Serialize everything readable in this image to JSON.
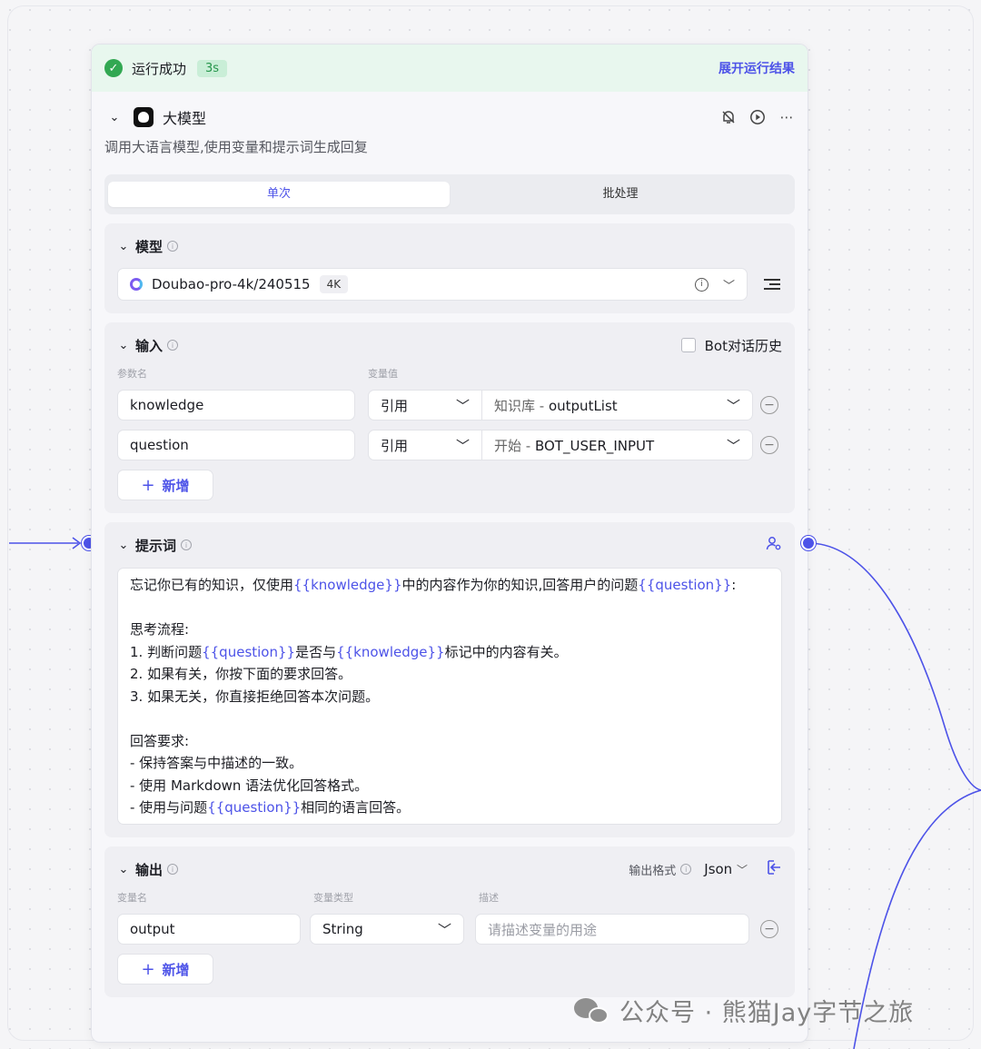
{
  "status": {
    "text": "运行成功",
    "duration": "3s",
    "expand_link": "展开运行结果"
  },
  "node": {
    "title": "大模型",
    "description": "调用大语言模型,使用变量和提示词生成回复",
    "tabs": [
      {
        "label": "单次",
        "active": true
      },
      {
        "label": "批处理",
        "active": false
      }
    ]
  },
  "model_section": {
    "title": "模型",
    "selected_model": "Doubao-pro-4k/240515",
    "context_badge": "4K"
  },
  "input_section": {
    "title": "输入",
    "history_checkbox_label": "Bot对话历史",
    "history_checked": false,
    "col_param": "参数名",
    "col_value": "变量值",
    "rows": [
      {
        "name": "knowledge",
        "type": "引用",
        "source": "知识库",
        "value": "outputList"
      },
      {
        "name": "question",
        "type": "引用",
        "source": "开始",
        "value": "BOT_USER_INPUT"
      }
    ],
    "separator": " - ",
    "add_label": "新增"
  },
  "prompt_section": {
    "title": "提示词",
    "lines": [
      [
        {
          "t": "忘记你已有的知识，仅使用"
        },
        {
          "t": "{{knowledge}}",
          "v": true
        },
        {
          "t": "中的内容作为你的知识,回答用户的问题"
        },
        {
          "t": "{{question}}",
          "v": true
        },
        {
          "t": ":"
        }
      ],
      [],
      [
        {
          "t": "思考流程:"
        }
      ],
      [
        {
          "t": "1. 判断问题"
        },
        {
          "t": "{{question}}",
          "v": true
        },
        {
          "t": "是否与"
        },
        {
          "t": "{{knowledge}}",
          "v": true
        },
        {
          "t": "标记中的内容有关。"
        }
      ],
      [
        {
          "t": "2. 如果有关，你按下面的要求回答。"
        }
      ],
      [
        {
          "t": "3. 如果无关，你直接拒绝回答本次问题。"
        }
      ],
      [],
      [
        {
          "t": "回答要求:"
        }
      ],
      [
        {
          "t": "- 保持答案与中描述的一致。"
        }
      ],
      [
        {
          "t": "- 使用 Markdown 语法优化回答格式。"
        }
      ],
      [
        {
          "t": "- 使用与问题"
        },
        {
          "t": "{{question}}",
          "v": true
        },
        {
          "t": "相同的语言回答。"
        }
      ]
    ]
  },
  "output_section": {
    "title": "输出",
    "format_label": "输出格式",
    "format_value": "Json",
    "col_name": "变量名",
    "col_type": "变量类型",
    "col_desc": "描述",
    "rows": [
      {
        "name": "output",
        "type": "String",
        "desc_placeholder": "请描述变量的用途"
      }
    ],
    "add_label": "新增"
  },
  "watermark": "公众号 · 熊猫Jay字节之旅",
  "colors": {
    "accent": "#4d53e8",
    "success": "#32a852",
    "success_bg": "#e8f7ee"
  }
}
